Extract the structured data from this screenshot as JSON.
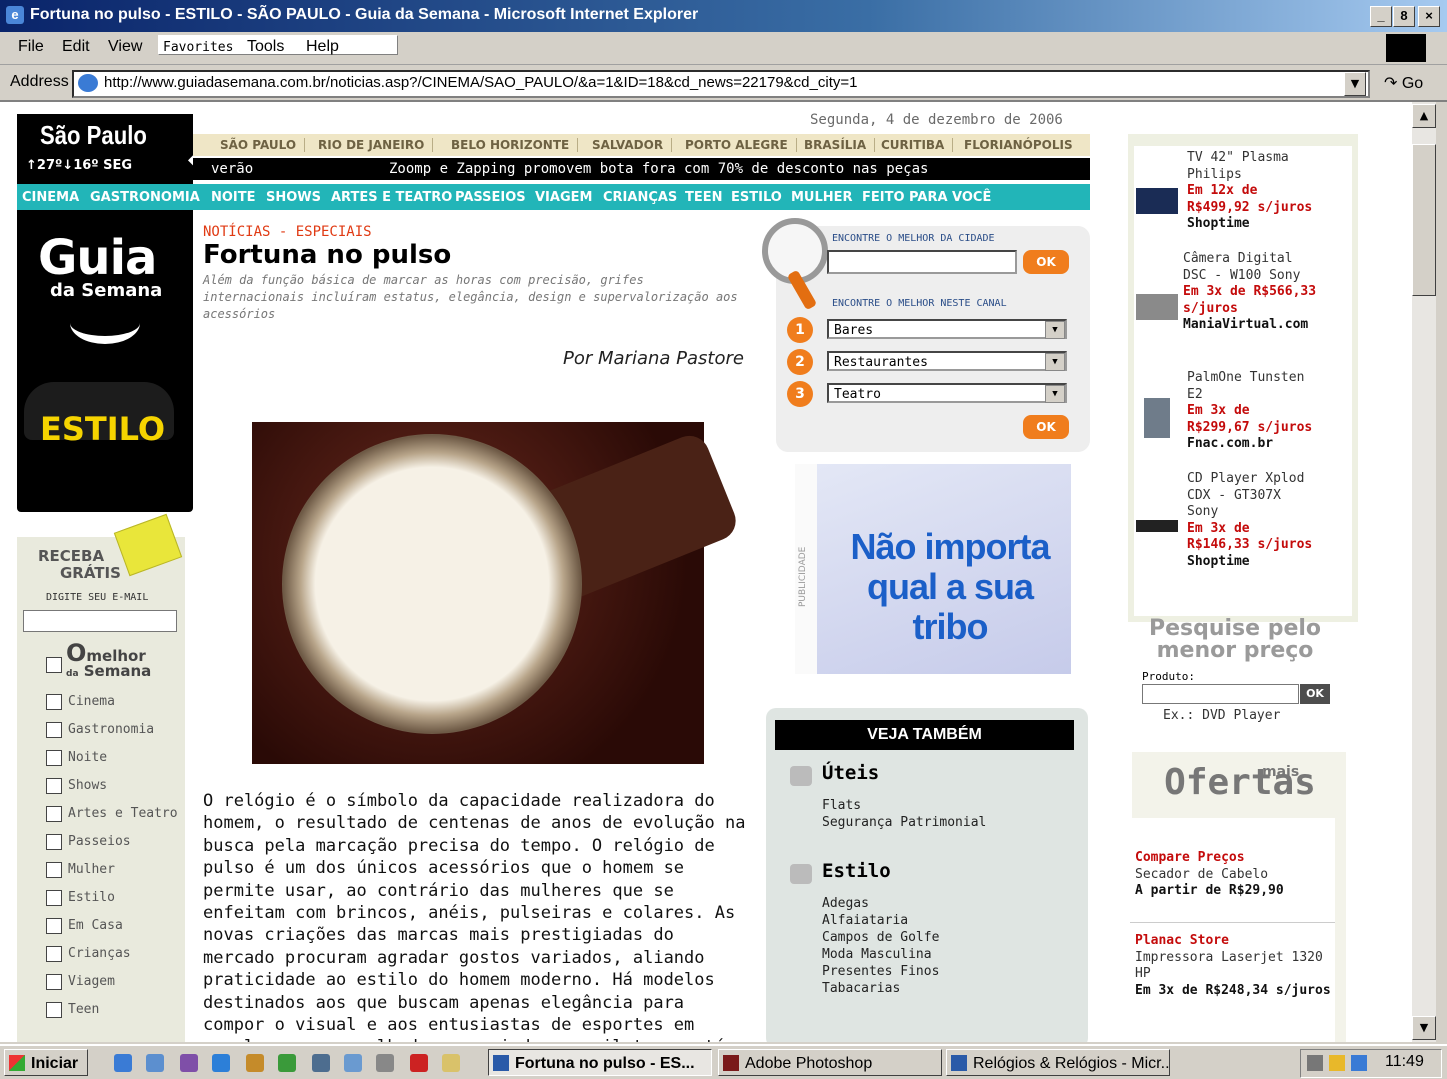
{
  "window": {
    "title": "Fortuna no pulso - ESTILO - SÃO PAULO - Guia da Semana - Microsoft Internet Explorer",
    "controls": [
      "_",
      "8",
      "×"
    ]
  },
  "menu": [
    "File",
    "Edit",
    "View",
    "Favorites",
    "Tools",
    "Help"
  ],
  "address": {
    "label": "Address",
    "url": "http://www.guiadasemana.com.br/noticias.asp?/CINEMA/SAO_PAULO/&a=1&ID=18&cd_news=22179&cd_city=1",
    "go": "Go"
  },
  "site": {
    "city": "São Paulo",
    "weather": "↑27º↓16º  SEG",
    "logo_main": "Guia",
    "logo_sub": "da Semana",
    "section": "ESTILO",
    "date": "Segunda, 4 de dezembro de 2006",
    "city_tabs": [
      "SÃO PAULO",
      "RIO DE JANEIRO",
      "BELO HORIZONTE",
      "SALVADOR",
      "PORTO ALEGRE",
      "BRASÍLIA",
      "CURITIBA",
      "FLORIANÓPOLIS"
    ],
    "ticker_label": "verão",
    "ticker_text": "Zoomp e Zapping promovem bota fora com 70% de desconto nas peças",
    "nav": [
      "CINEMA",
      "GASTRONOMIA",
      "NOITE",
      "SHOWS",
      "ARTES E TEATRO",
      "PASSEIOS",
      "VIAGEM",
      "CRIANÇAS",
      "TEEN",
      "ESTILO",
      "MULHER",
      "FEITO PARA VOCÊ"
    ]
  },
  "article": {
    "kicker": "NOTÍCIAS - ESPECIAIS",
    "title": "Fortuna no pulso",
    "subtitle": "Além da função básica de marcar as horas com precisão, grifes internacionais incluíram estatus, elegância, design e supervalorização aos acessórios",
    "byline": "Por Mariana Pastore",
    "body": "O relógio é o símbolo da capacidade realizadora do homem, o resultado de centenas de anos de evolução na busca pela marcação precisa do tempo. O relógio de pulso é um dos únicos acessórios que o homem se permite usar, ao contrário das mulheres que se enfeitam com brincos, anéis, pulseiras e colares. As novas criações das marcas mais prestigiadas do mercado procuram agradar gostos variados, aliando praticidade ao estilo do homem moderno. Há modelos destinados aos que buscam apenas elegância para compor o visual e aos entusiastas de esportes em geral, como mergulhadores, aviadores, pilotos e até"
  },
  "newsletter": {
    "title1": "RECEBA",
    "title2": "GRÁTIS",
    "hint": "DIGITE SEU E-MAIL",
    "brand_o": "O",
    "brand_melhor": "melhor",
    "brand_da": "da",
    "brand_semana": "Semana",
    "items": [
      "Cinema",
      "Gastronomia",
      "Noite",
      "Shows",
      "Artes e Teatro",
      "Passeios",
      "Mulher",
      "Estilo",
      "Em Casa",
      "Crianças",
      "Viagem",
      "Teen"
    ]
  },
  "search": {
    "label_city": "ENCONTRE O MELHOR DA CIDADE",
    "label_channel": "ENCONTRE O MELHOR NESTE CANAL",
    "ok": "OK",
    "selects": [
      "Bares",
      "Restaurantes",
      "Teatro"
    ],
    "numbers": [
      "1",
      "2",
      "3"
    ]
  },
  "ad": {
    "tag": "PUBLICIDADE",
    "text": "Não importa qual a sua tribo"
  },
  "veja": {
    "header": "VEJA TAMBÉM",
    "sections": [
      {
        "title": "Úteis",
        "links": [
          "Flats",
          "Segurança Patrimonial"
        ]
      },
      {
        "title": "Estilo",
        "links": [
          "Adegas",
          "Alfaiataria",
          "Campos de Golfe",
          "Moda Masculina",
          "Presentes Finos",
          "Tabacarias"
        ]
      }
    ]
  },
  "products": [
    {
      "name": "TV 42\" Plasma Philips",
      "price": "Em 12x de R$499,92 s/juros",
      "store": "Shoptime"
    },
    {
      "name": "Câmera Digital DSC - W100 Sony",
      "price": "Em 3x de R$566,33 s/juros",
      "store": "ManiaVirtual.com"
    },
    {
      "name": "PalmOne Tunsten E2",
      "price": "Em 3x de R$299,67 s/juros",
      "store": "Fnac.com.br"
    },
    {
      "name": "CD Player Xplod CDX - GT307X Sony",
      "price": "Em 3x de R$146,33 s/juros",
      "store": "Shoptime"
    }
  ],
  "price_search": {
    "title": "Pesquise pelo menor preço",
    "label": "Produto:",
    "ok": "OK",
    "example": "Ex.: DVD Player"
  },
  "offers": {
    "mais": "mais",
    "title": "Ofertas",
    "items": [
      {
        "head": "Compare Preços",
        "desc": "Secador de Cabelo",
        "price": "A partir de R$29,90"
      },
      {
        "head": "Planac Store",
        "desc": "Impressora Laserjet 1320 HP",
        "price": "Em 3x de R$248,34 s/juros"
      }
    ]
  },
  "taskbar": {
    "start": "Iniciar",
    "tasks": [
      "Fortuna no pulso - ES...",
      "Adobe Photoshop",
      "Relógios & Relógios - Micr..."
    ],
    "clock": "11:49"
  }
}
